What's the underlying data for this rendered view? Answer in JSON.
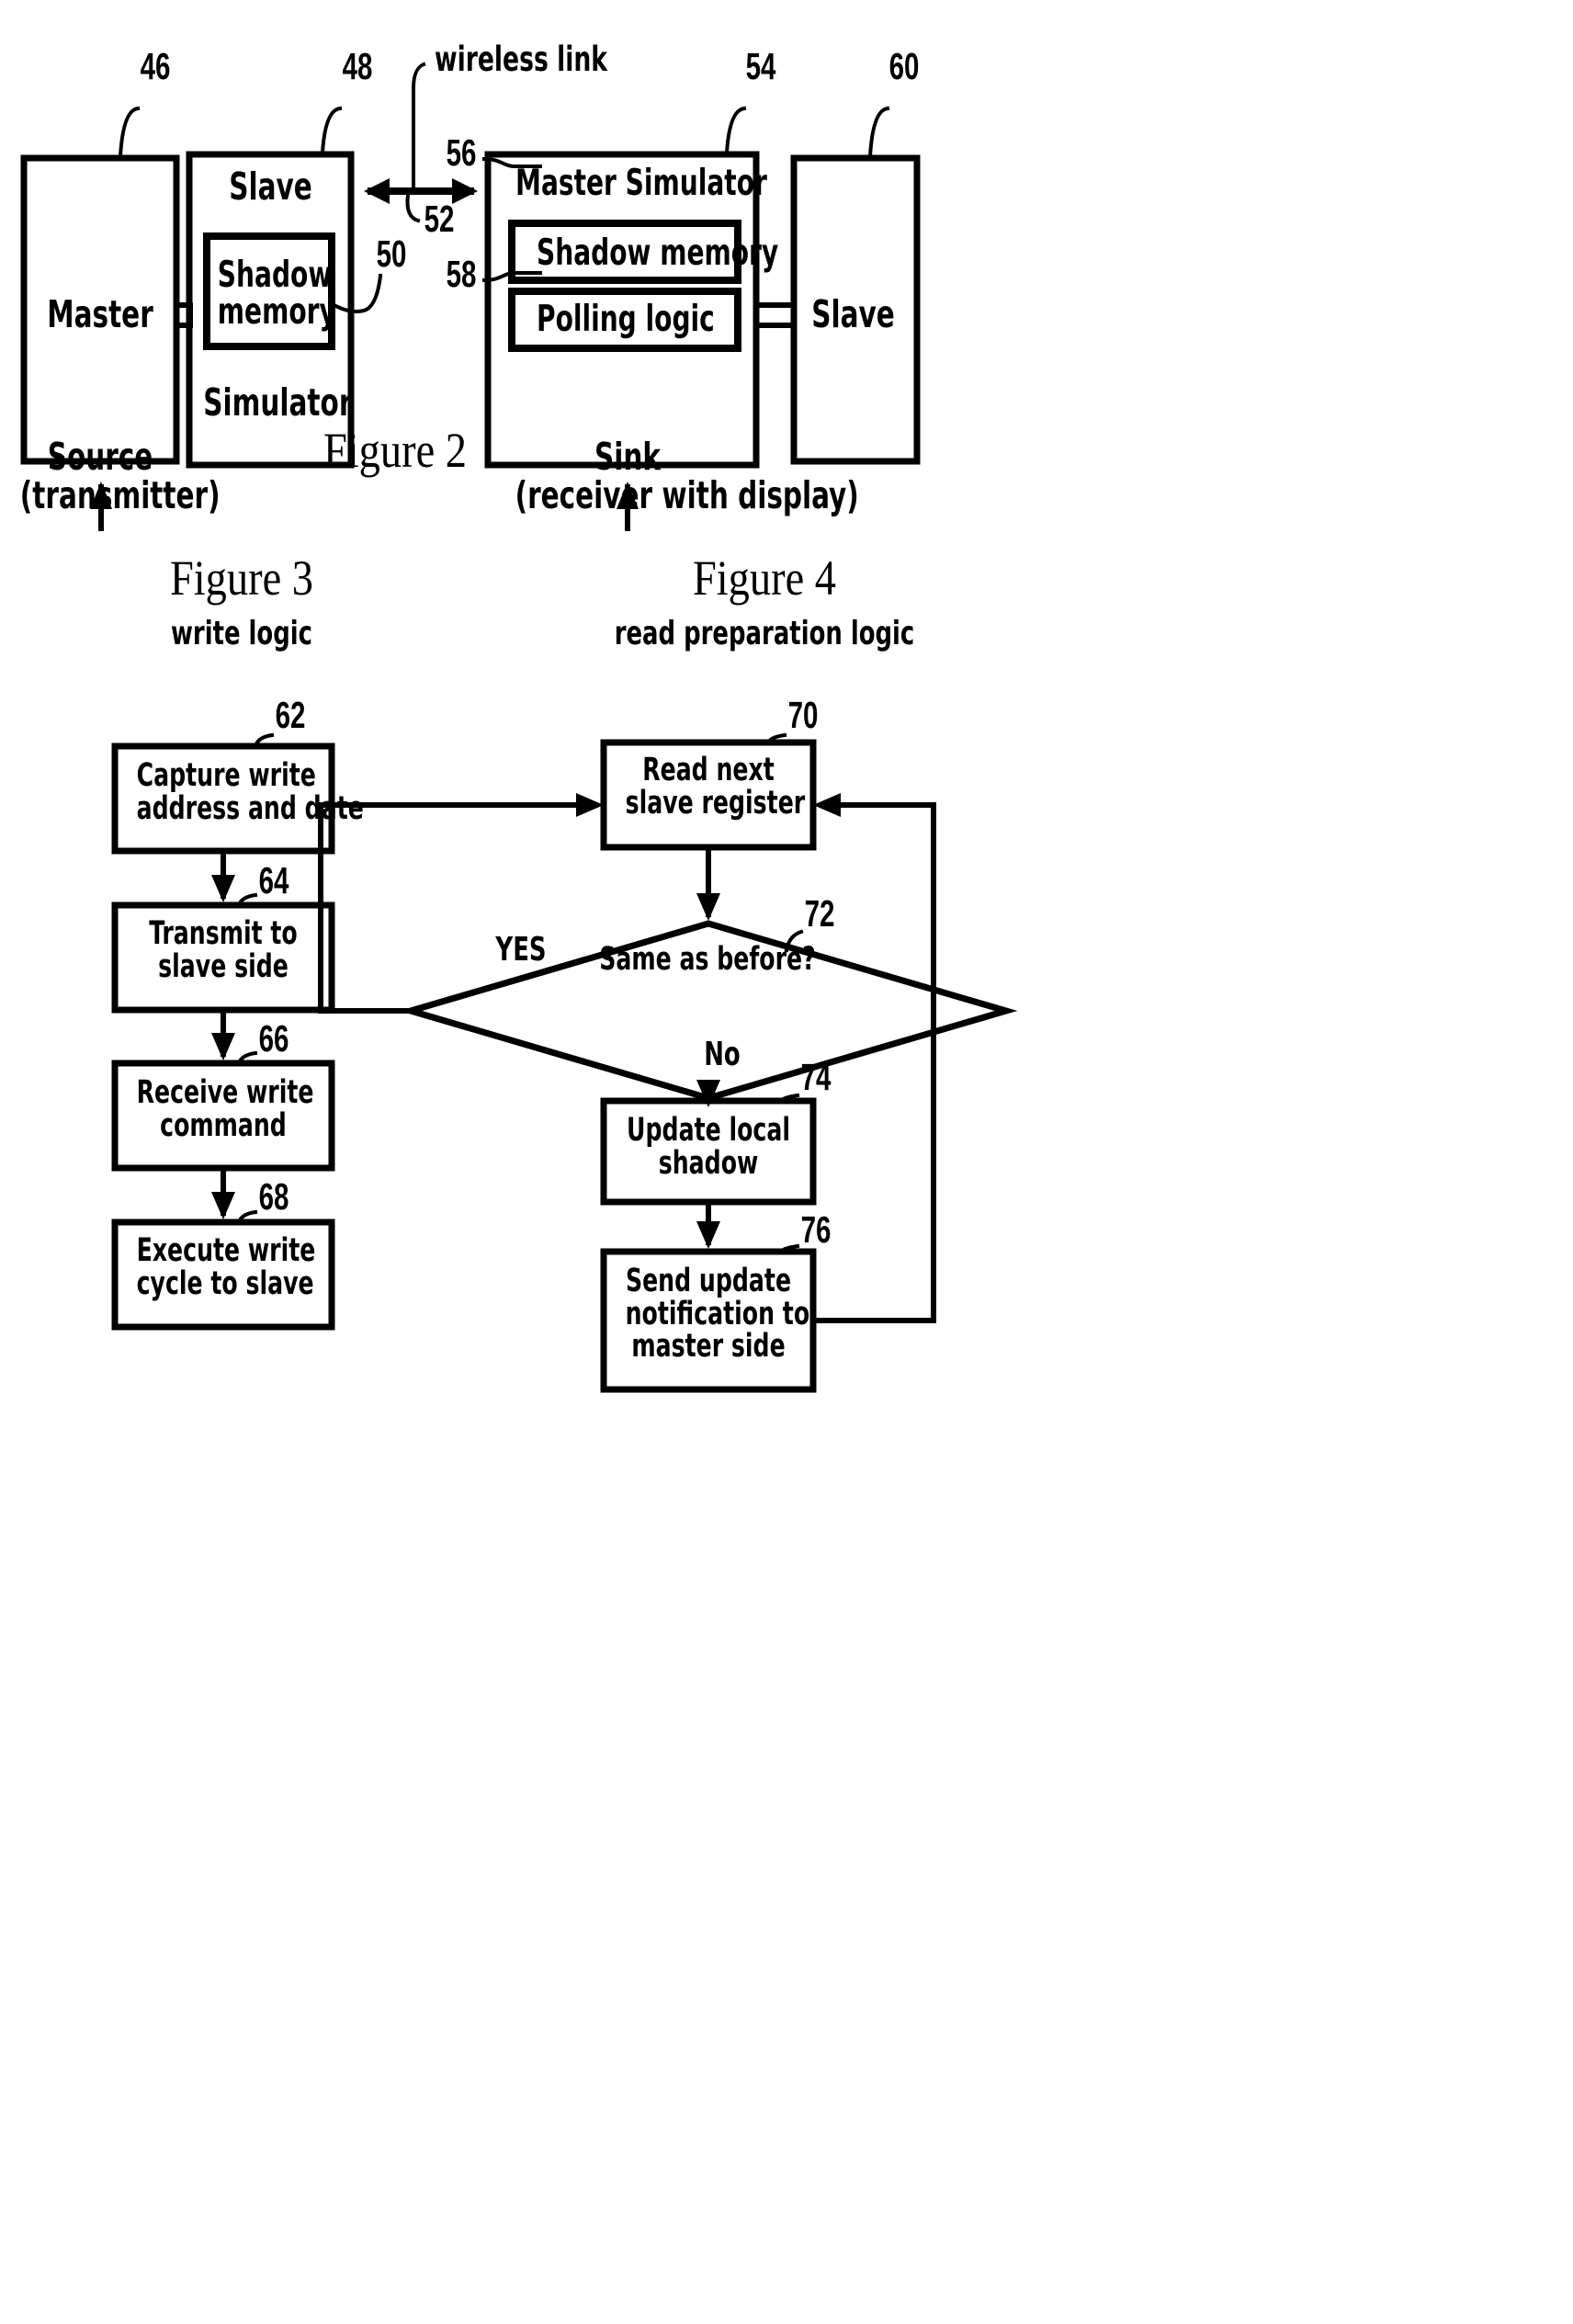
{
  "figure2": {
    "caption": "Figure 2",
    "blocks": {
      "master": "Master",
      "slave_title": "Slave",
      "shadow_memory_left": "Shadow\nmemory",
      "simulator": "Simulator",
      "master_simulator": "Master Simulator",
      "shadow_memory_right": "Shadow memory",
      "polling_logic": "Polling logic",
      "slave_right": "Slave"
    },
    "link_label": "wireless link",
    "side_labels": {
      "source_line1": "Source",
      "source_line2": "(transmitter)",
      "sink_line1": "Sink",
      "sink_line2": "(receiver with display)"
    },
    "numerals": {
      "master": "46",
      "slave_simulator": "48",
      "shadow_memory_left": "50",
      "wireless_link": "52",
      "master_simulator": "54",
      "shadow_memory_right": "56",
      "polling_logic": "58",
      "slave_right": "60"
    }
  },
  "figure3": {
    "caption": "Figure 3",
    "subtitle": "write logic",
    "steps": [
      {
        "numeral": "62",
        "text": "Capture write\naddress and date"
      },
      {
        "numeral": "64",
        "text": "Transmit to\nslave side"
      },
      {
        "numeral": "66",
        "text": "Receive write\ncommand"
      },
      {
        "numeral": "68",
        "text": "Execute write\ncycle to slave"
      }
    ]
  },
  "figure4": {
    "caption": "Figure 4",
    "subtitle": "read preparation logic",
    "steps": [
      {
        "numeral": "70",
        "text": "Read next\nslave register"
      },
      {
        "numeral": "72",
        "text": "Same as before?"
      },
      {
        "numeral": "74",
        "text": "Update local\nshadow"
      },
      {
        "numeral": "76",
        "text": "Send update\nnotification to\nmaster side"
      }
    ],
    "branch_labels": {
      "yes": "YES",
      "no": "No"
    }
  },
  "colors": {
    "ink": "#000000",
    "paper": "#ffffff"
  }
}
